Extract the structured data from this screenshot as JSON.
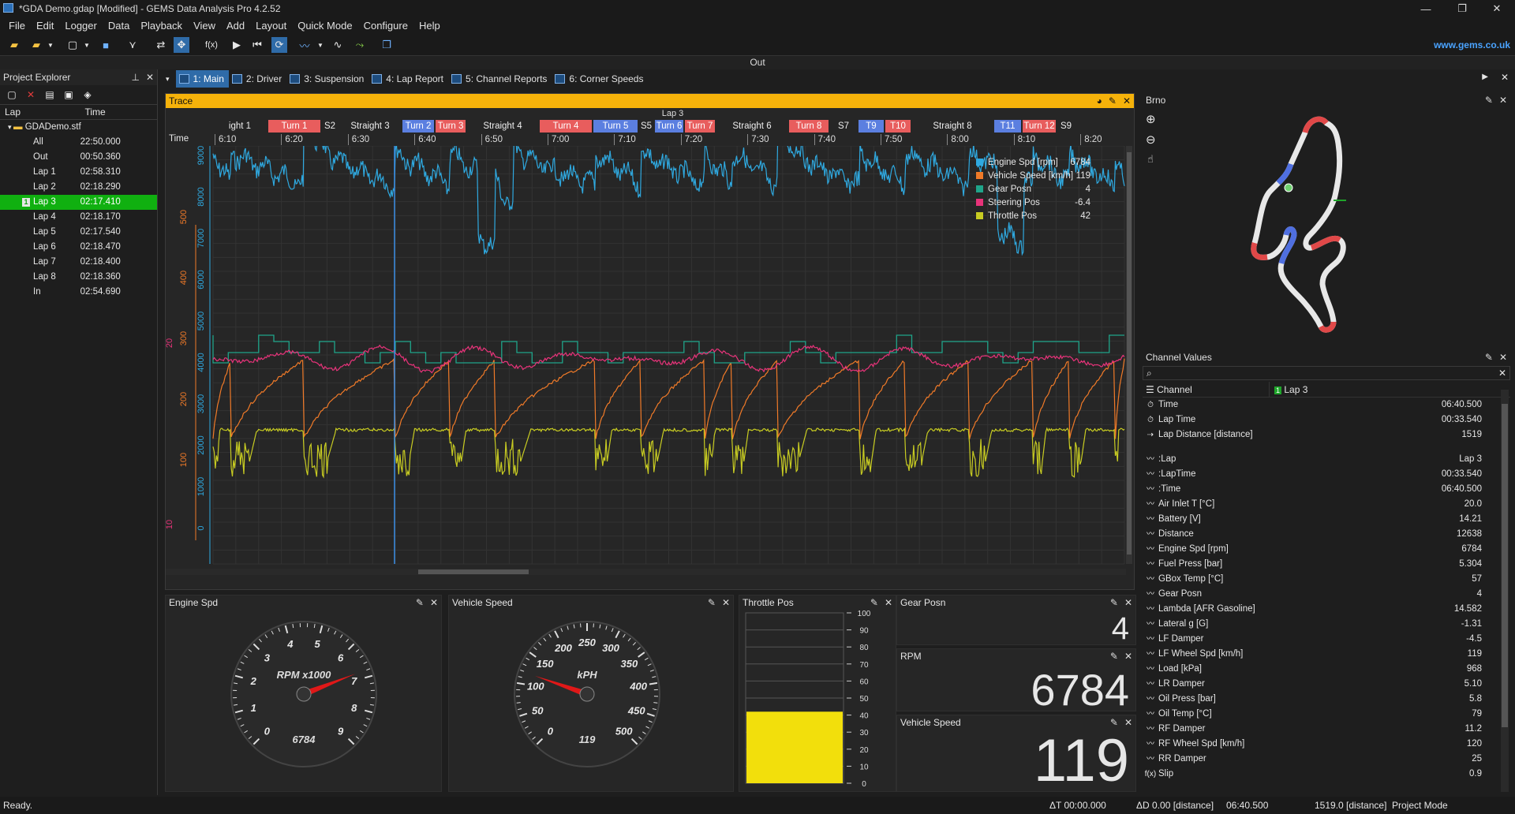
{
  "window": {
    "title": "*GDA Demo.gdap [Modified] - GEMS Data Analysis Pro 4.2.52",
    "controls": [
      "—",
      "❐",
      "✕"
    ]
  },
  "menu": [
    "File",
    "Edit",
    "Logger",
    "Data",
    "Playback",
    "View",
    "Add",
    "Layout",
    "Quick Mode",
    "Configure",
    "Help"
  ],
  "toolbar": {
    "fx_label": "f(x)",
    "website": "www.gems.co.uk"
  },
  "outbar": {
    "label": "Out"
  },
  "explorer": {
    "title": "Project Explorer",
    "col_lap": "Lap",
    "col_time": "Time",
    "root": "GDADemo.stf",
    "rows": [
      {
        "lap": "All",
        "time": "22:50.000"
      },
      {
        "lap": "Out",
        "time": "00:50.360"
      },
      {
        "lap": "Lap 1",
        "time": "02:58.310"
      },
      {
        "lap": "Lap 2",
        "time": "02:18.290"
      },
      {
        "lap": "Lap 3",
        "time": "02:17.410",
        "selected": true
      },
      {
        "lap": "Lap 4",
        "time": "02:18.170"
      },
      {
        "lap": "Lap 5",
        "time": "02:17.540"
      },
      {
        "lap": "Lap 6",
        "time": "02:18.470"
      },
      {
        "lap": "Lap 7",
        "time": "02:18.400"
      },
      {
        "lap": "Lap 8",
        "time": "02:18.360"
      },
      {
        "lap": "In",
        "time": "02:54.690"
      }
    ]
  },
  "tabs": [
    {
      "label": "1: Main",
      "active": true
    },
    {
      "label": "2: Driver"
    },
    {
      "label": "3: Suspension"
    },
    {
      "label": "4: Lap Report"
    },
    {
      "label": "5: Channel Reports"
    },
    {
      "label": "6: Corner Speeds"
    }
  ],
  "trace": {
    "title": "Trace",
    "lap_label": "Lap 3",
    "time_label": "Time",
    "segments": [
      {
        "label": "ight 1",
        "type": "plain"
      },
      {
        "label": "Turn 1",
        "type": "turn"
      },
      {
        "label": "S2",
        "type": "plain"
      },
      {
        "label": "Straight 3",
        "type": "plain"
      },
      {
        "label": "Turn 2",
        "type": "turnb"
      },
      {
        "label": "Turn 3",
        "type": "turn"
      },
      {
        "label": "Straight 4",
        "type": "plain"
      },
      {
        "label": "Turn 4",
        "type": "turn"
      },
      {
        "label": "Turn 5",
        "type": "turnb"
      },
      {
        "label": "S5",
        "type": "plain"
      },
      {
        "label": "Turn 6",
        "type": "turnb"
      },
      {
        "label": "Turn 7",
        "type": "turn"
      },
      {
        "label": "Straight 6",
        "type": "plain"
      },
      {
        "label": "Turn 8",
        "type": "turn"
      },
      {
        "label": "S7",
        "type": "plain"
      },
      {
        "label": "T9",
        "type": "turnb"
      },
      {
        "label": "T10",
        "type": "turn"
      },
      {
        "label": "Straight 8",
        "type": "plain"
      },
      {
        "label": "T11",
        "type": "turnb"
      },
      {
        "label": "Turn 12",
        "type": "turn"
      },
      {
        "label": "S9",
        "type": "plain"
      }
    ],
    "time_ticks": [
      "6:10",
      "6:20",
      "6:30",
      "6:40",
      "6:50",
      "7:00",
      "7:10",
      "7:20",
      "7:30",
      "7:40",
      "7:50",
      "8:00",
      "8:10",
      "8:20"
    ],
    "rpm_ticks": [
      "9000",
      "8000",
      "7000",
      "6000",
      "5000",
      "4000",
      "3000",
      "2000",
      "1000",
      "0"
    ],
    "speed_ticks": [
      "500",
      "400",
      "300",
      "200",
      "100"
    ],
    "gear_ticks": [
      "20",
      "10"
    ],
    "legend": [
      {
        "name": "Engine Spd [rpm]",
        "value": "6784",
        "color": "#2fa9e0"
      },
      {
        "name": "Vehicle Speed [km/h]",
        "value": "119",
        "color": "#f07a28"
      },
      {
        "name": "Gear Posn",
        "value": "4",
        "color": "#1fa58a"
      },
      {
        "name": "Steering Pos",
        "value": "-6.4",
        "color": "#e8337a"
      },
      {
        "name": "Throttle Pos",
        "value": "42",
        "color": "#c8cc22"
      }
    ],
    "colors": {
      "rpm": "#2fa9e0",
      "speed": "#f07a28",
      "gear": "#1fa58a",
      "steer": "#e8337a",
      "throttle": "#c8cc22",
      "cursor": "#3a8ee6"
    }
  },
  "map": {
    "title": "Brno"
  },
  "channels": {
    "title": "Channel Values",
    "col_channel": "Channel",
    "col_lap": "Lap 3",
    "top_rows": [
      {
        "name": "Time",
        "value": "06:40.500",
        "icon": "clock"
      },
      {
        "name": "Lap Time",
        "value": "00:33.540",
        "icon": "clock"
      },
      {
        "name": "Lap Distance [distance]",
        "value": "1519",
        "icon": "dist"
      }
    ],
    "rows": [
      {
        "name": ":Lap",
        "value": "Lap 3",
        "icon": "trend"
      },
      {
        "name": ":LapTime",
        "value": "00:33.540",
        "icon": "trend"
      },
      {
        "name": ":Time",
        "value": "06:40.500",
        "icon": "trend"
      },
      {
        "name": "Air Inlet T [°C]",
        "value": "20.0",
        "icon": "trend"
      },
      {
        "name": "Battery [V]",
        "value": "14.21",
        "icon": "trend"
      },
      {
        "name": "Distance",
        "value": "12638",
        "icon": "trend"
      },
      {
        "name": "Engine Spd [rpm]",
        "value": "6784",
        "icon": "trend"
      },
      {
        "name": "Fuel Press [bar]",
        "value": "5.304",
        "icon": "trend"
      },
      {
        "name": "GBox Temp [°C]",
        "value": "57",
        "icon": "trend"
      },
      {
        "name": "Gear Posn",
        "value": "4",
        "icon": "trend"
      },
      {
        "name": "Lambda [AFR Gasoline]",
        "value": "14.582",
        "icon": "trend"
      },
      {
        "name": "Lateral g [G]",
        "value": "-1.31",
        "icon": "trend"
      },
      {
        "name": "LF Damper",
        "value": "-4.5",
        "icon": "trend"
      },
      {
        "name": "LF Wheel Spd [km/h]",
        "value": "119",
        "icon": "trend"
      },
      {
        "name": "Load [kPa]",
        "value": "968",
        "icon": "trend"
      },
      {
        "name": "LR Damper",
        "value": "5.10",
        "icon": "trend"
      },
      {
        "name": "Oil Press [bar]",
        "value": "5.8",
        "icon": "trend"
      },
      {
        "name": "Oil Temp [°C]",
        "value": "79",
        "icon": "trend"
      },
      {
        "name": "RF Damper",
        "value": "11.2",
        "icon": "trend"
      },
      {
        "name": "RF Wheel Spd [km/h]",
        "value": "120",
        "icon": "trend"
      },
      {
        "name": "RR Damper",
        "value": "25",
        "icon": "trend"
      },
      {
        "name": "Slip",
        "value": "0.9",
        "icon": "fx"
      }
    ]
  },
  "gauges": {
    "engine": {
      "title": "Engine Spd",
      "unit": "RPM x1000",
      "value": "6784",
      "value_num": 6.784,
      "max": 9,
      "ticks": [
        "0",
        "1",
        "2",
        "3",
        "4",
        "5",
        "6",
        "7",
        "8",
        "9"
      ]
    },
    "speed": {
      "title": "Vehicle Speed",
      "unit": "kPH",
      "value": "119",
      "value_num": 119,
      "max": 500,
      "ticks": [
        "0",
        "50",
        "100",
        "150",
        "200",
        "250",
        "300",
        "350",
        "400",
        "450",
        "500"
      ]
    },
    "throttle": {
      "title": "Throttle Pos",
      "value_num": 42,
      "ticks": [
        "100",
        "90",
        "80",
        "70",
        "60",
        "50",
        "40",
        "30",
        "20",
        "10",
        "0"
      ]
    },
    "gear": {
      "title": "Gear Posn",
      "value": "4"
    },
    "rpm": {
      "title": "RPM",
      "value": "6784"
    },
    "vspeed": {
      "title": "Vehicle Speed",
      "value": "119"
    }
  },
  "status": {
    "ready": "Ready.",
    "dt": "ΔT 00:00.000",
    "dd": "ΔD 0.00 [distance]",
    "time": "06:40.500",
    "dist": "1519.0 [distance]",
    "mode": "Project Mode"
  }
}
